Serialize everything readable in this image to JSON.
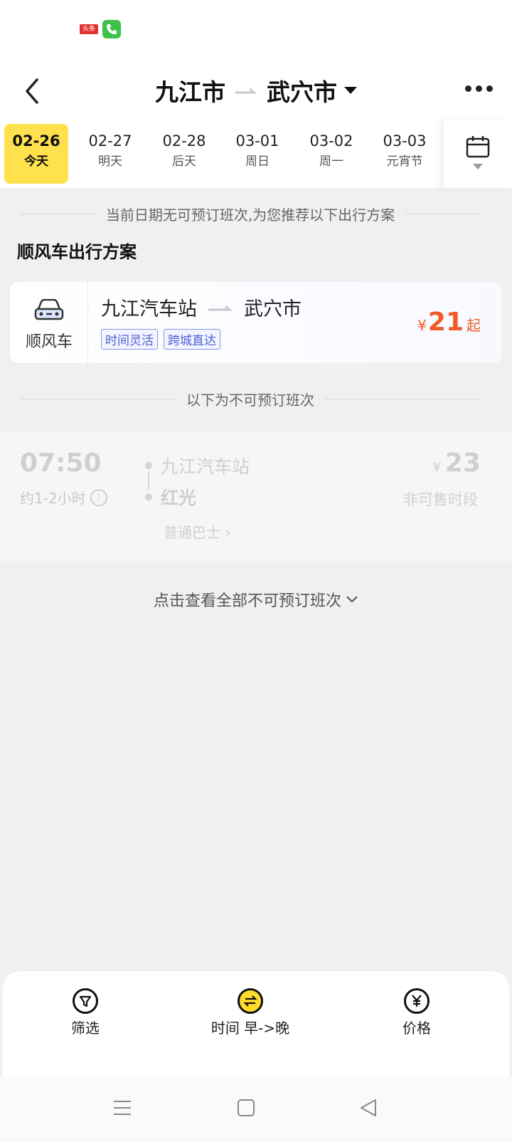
{
  "status_bar": {
    "news_icon_text": "头条",
    "icons": [
      "news-icon",
      "phone-icon"
    ]
  },
  "header": {
    "from_city": "九江市",
    "to_city": "武穴市"
  },
  "dates": [
    {
      "date": "02-26",
      "weekday": "今天",
      "active": true
    },
    {
      "date": "02-27",
      "weekday": "明天",
      "active": false
    },
    {
      "date": "02-28",
      "weekday": "后天",
      "active": false
    },
    {
      "date": "03-01",
      "weekday": "周日",
      "active": false
    },
    {
      "date": "03-02",
      "weekday": "周一",
      "active": false
    },
    {
      "date": "03-03",
      "weekday": "元宵节",
      "active": false
    }
  ],
  "notice": "当前日期无可预订班次,为您推荐以下出行方案",
  "ride_section": {
    "title": "顺风车出行方案",
    "card": {
      "type_label": "顺风车",
      "from": "九江汽车站",
      "to": "武穴市",
      "tags": [
        "时间灵活",
        "跨城直达"
      ],
      "currency": "¥",
      "price": "21",
      "price_suffix": "起"
    }
  },
  "unavailable_divider": "以下为不可预订班次",
  "trips": [
    {
      "time": "07:50",
      "duration": "约1-2小时",
      "from_stop": "九江汽车站",
      "to_stop": "红光",
      "bus_type": "普通巴士 ›",
      "currency": "¥",
      "price": "23",
      "status": "非可售时段"
    }
  ],
  "view_all": "点击查看全部不可预订班次",
  "bottom_bar": {
    "filter_label": "筛选",
    "time_sort_label": "时间 早->晚",
    "price_label": "价格"
  },
  "colors": {
    "accent_yellow": "#ffe14d",
    "price_orange": "#f05b28",
    "tag_blue": "#4b5fd6"
  }
}
